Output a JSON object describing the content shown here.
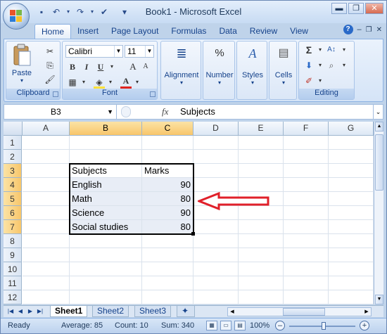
{
  "window": {
    "title": "Book1 - Microsoft Excel",
    "controls": {
      "minimize": "▬",
      "maximize": "❐",
      "close": "✕"
    },
    "doc_controls": {
      "minimize": "–",
      "restore": "❐",
      "close": "✕"
    }
  },
  "quick_access": [
    {
      "name": "save-icon",
      "glyph": "💾"
    },
    {
      "name": "undo-icon",
      "glyph": "↶"
    },
    {
      "name": "undo-dropdown-icon",
      "glyph": "▾"
    },
    {
      "name": "redo-icon",
      "glyph": "↷"
    },
    {
      "name": "redo-dropdown-icon",
      "glyph": "▾"
    },
    {
      "name": "spelling-icon",
      "glyph": "✔"
    },
    {
      "name": "customize-qat-icon",
      "glyph": "≡"
    }
  ],
  "ribbon_tabs": [
    "Home",
    "Insert",
    "Page Layout",
    "Formulas",
    "Data",
    "Review",
    "View"
  ],
  "active_tab": "Home",
  "clipboard": {
    "label": "Clipboard",
    "paste": "Paste"
  },
  "font": {
    "label": "Font",
    "name": "Calibri",
    "size": "11",
    "bold": "B",
    "italic": "I",
    "underline": "U",
    "grow": "A",
    "shrink": "A",
    "font_color": "A",
    "fill_color_red": "#d7261e",
    "font_color_red": "#e0241e",
    "fill_color_yellow": "#ffe23a"
  },
  "alignment": {
    "label": "Alignment"
  },
  "number": {
    "label": "Number",
    "icon_glyph": "%"
  },
  "styles": {
    "label": "Styles"
  },
  "cells": {
    "label": "Cells"
  },
  "editing": {
    "label": "Editing",
    "sum_glyph": "Σ",
    "sort_glyph": "A/Z"
  },
  "formula_bar": {
    "name_box": "B3",
    "fx": "fx",
    "content": "Subjects"
  },
  "columns": [
    "A",
    "B",
    "C",
    "D",
    "E",
    "F",
    "G"
  ],
  "rows": [
    "1",
    "2",
    "3",
    "4",
    "5",
    "6",
    "7",
    "8",
    "9",
    "10",
    "11",
    "12"
  ],
  "table": [
    {
      "subject": "Subjects",
      "mark": "Marks"
    },
    {
      "subject": "English",
      "mark": "90"
    },
    {
      "subject": "Math",
      "mark": "80"
    },
    {
      "subject": "Science",
      "mark": "90"
    },
    {
      "subject": "Social studies",
      "mark": "80"
    }
  ],
  "annotation_arrow_color": "#e0202a",
  "sheets": [
    "Sheet1",
    "Sheet2",
    "Sheet3"
  ],
  "active_sheet": "Sheet1",
  "status": {
    "ready": "Ready",
    "average": "Average: 85",
    "count": "Count: 10",
    "sum": "Sum: 340",
    "zoom": "100%"
  }
}
